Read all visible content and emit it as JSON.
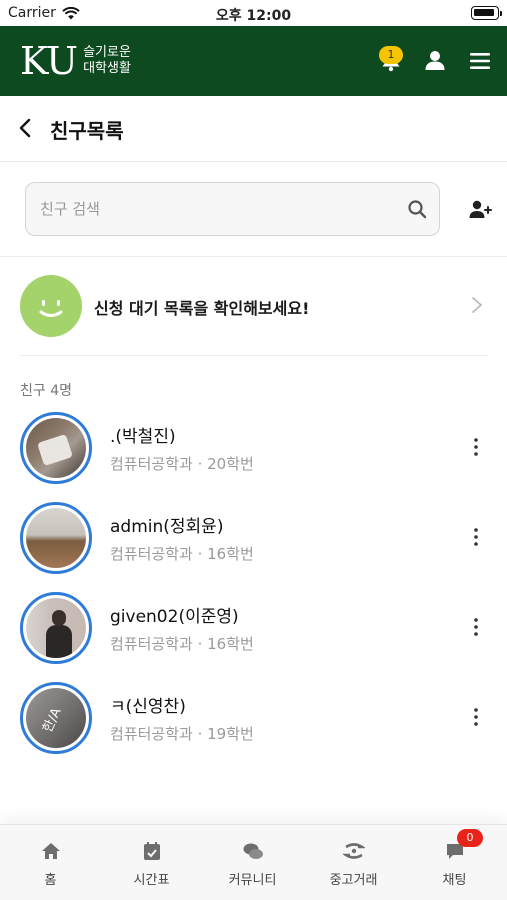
{
  "status_bar": {
    "carrier": "Carrier",
    "time": "오후 12:00"
  },
  "app_header": {
    "logo_main": "KU",
    "logo_sub_line1": "슬기로운",
    "logo_sub_line2": "대학생활",
    "notification_count": "1",
    "brand_color": "#0d4a20"
  },
  "page": {
    "title": "친구목록"
  },
  "search": {
    "placeholder": "친구 검색",
    "value": ""
  },
  "pending": {
    "text": "신청 대기 목록을 확인해보세요!"
  },
  "friends": {
    "count_label": "친구 4명",
    "items": [
      {
        "name": ".(박철진)",
        "meta": "컴퓨터공학과 · 20학번"
      },
      {
        "name": "admin(정회윤)",
        "meta": "컴퓨터공학과 · 16학번"
      },
      {
        "name": "given02(이준영)",
        "meta": "컴퓨터공학과 · 16학번"
      },
      {
        "name": "ㅋ(신영찬)",
        "meta": "컴퓨터공학과 · 19학번",
        "avatar_text": "한/A"
      }
    ]
  },
  "tabs": {
    "items": [
      {
        "label": "홈",
        "icon": "home-icon"
      },
      {
        "label": "시간표",
        "icon": "calendar-icon"
      },
      {
        "label": "커뮤니티",
        "icon": "chat-bubbles-icon"
      },
      {
        "label": "중고거래",
        "icon": "exchange-icon"
      },
      {
        "label": "채팅",
        "icon": "chat-icon"
      }
    ],
    "chat_badge": "0"
  }
}
